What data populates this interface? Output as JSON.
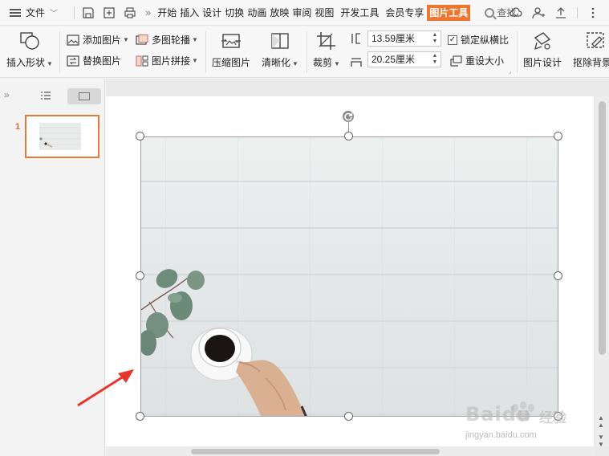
{
  "menubar": {
    "file_label": "文件",
    "tabs": [
      "开始",
      "插入",
      "设计",
      "切换",
      "动画",
      "放映",
      "审阅",
      "视图",
      "开发工具",
      "会员专享"
    ],
    "active_tab": "图片工具",
    "search_label": "查找"
  },
  "ribbon": {
    "insert_shape": "插入形状",
    "add_picture": "添加图片",
    "replace_picture": "替换图片",
    "multi_carousel": "多图轮播",
    "picture_stitch": "图片拼接",
    "compress_picture": "压缩图片",
    "sharpen": "清晰化",
    "crop": "裁剪",
    "height_value": "13.59厘米",
    "width_value": "20.25厘米",
    "lock_ratio": "锁定纵横比",
    "reset_size": "重设大小",
    "picture_design": "图片设计",
    "remove_bg": "抠除背景"
  },
  "slides_panel": {
    "slide_number": "1"
  },
  "watermark": {
    "brand": "Baidu",
    "sub": "经验",
    "url": "jingyan.baidu.com"
  },
  "colors": {
    "accent": "#f0762f",
    "selection_border": "#e4793a"
  }
}
